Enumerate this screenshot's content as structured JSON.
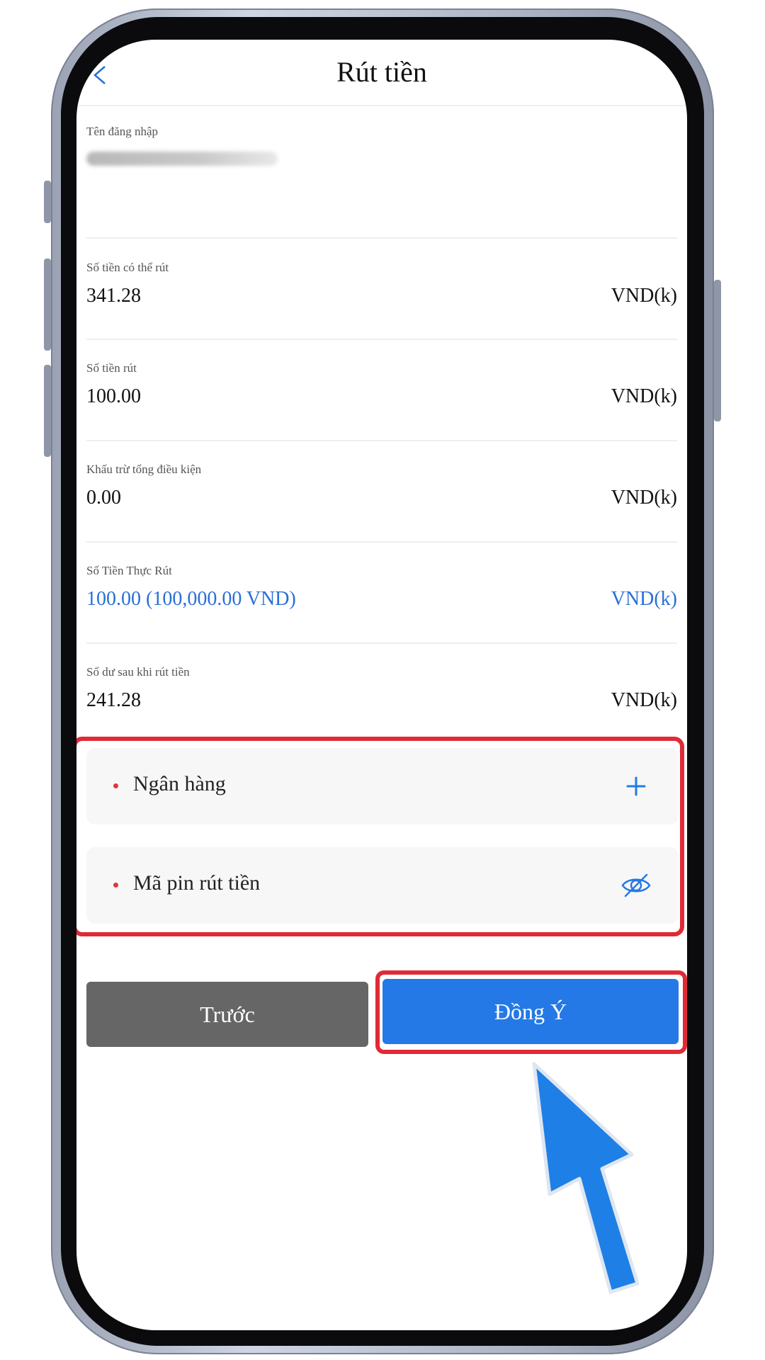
{
  "header": {
    "title": "Rút tiền"
  },
  "account": {
    "username_label": "Tên đăng nhập"
  },
  "rows": [
    {
      "label": "Số tiền có thể rút",
      "value": "341.28",
      "unit": "VND(k)"
    },
    {
      "label": "Số tiền rút",
      "value": "100.00",
      "unit": "VND(k)"
    },
    {
      "label": "Khấu trừ tổng điều kiện",
      "value": "0.00",
      "unit": "VND(k)"
    },
    {
      "label": "Số Tiền Thực Rút",
      "value": "100.00 (100,000.00 VND)",
      "unit": "VND(k)"
    },
    {
      "label": "Số dư sau khi rút tiền",
      "value": "241.28",
      "unit": "VND(k)"
    }
  ],
  "form": {
    "bank_label": "Ngân hàng",
    "pin_label": "Mã pin rút tiền"
  },
  "buttons": {
    "prev_label": "Trước",
    "ok_label": "Đồng Ý"
  },
  "icons": {
    "back": "back-arrow-icon",
    "add": "plus-icon",
    "visibility": "eye-slash-icon",
    "cursor": "pointer-arrow-icon"
  },
  "colors": {
    "accent_blue": "#2479e6",
    "value_blue": "#2a6fd6",
    "highlight_red": "#e02a35",
    "prev_button_gray": "#666666",
    "required_dot": "#e0353f"
  }
}
